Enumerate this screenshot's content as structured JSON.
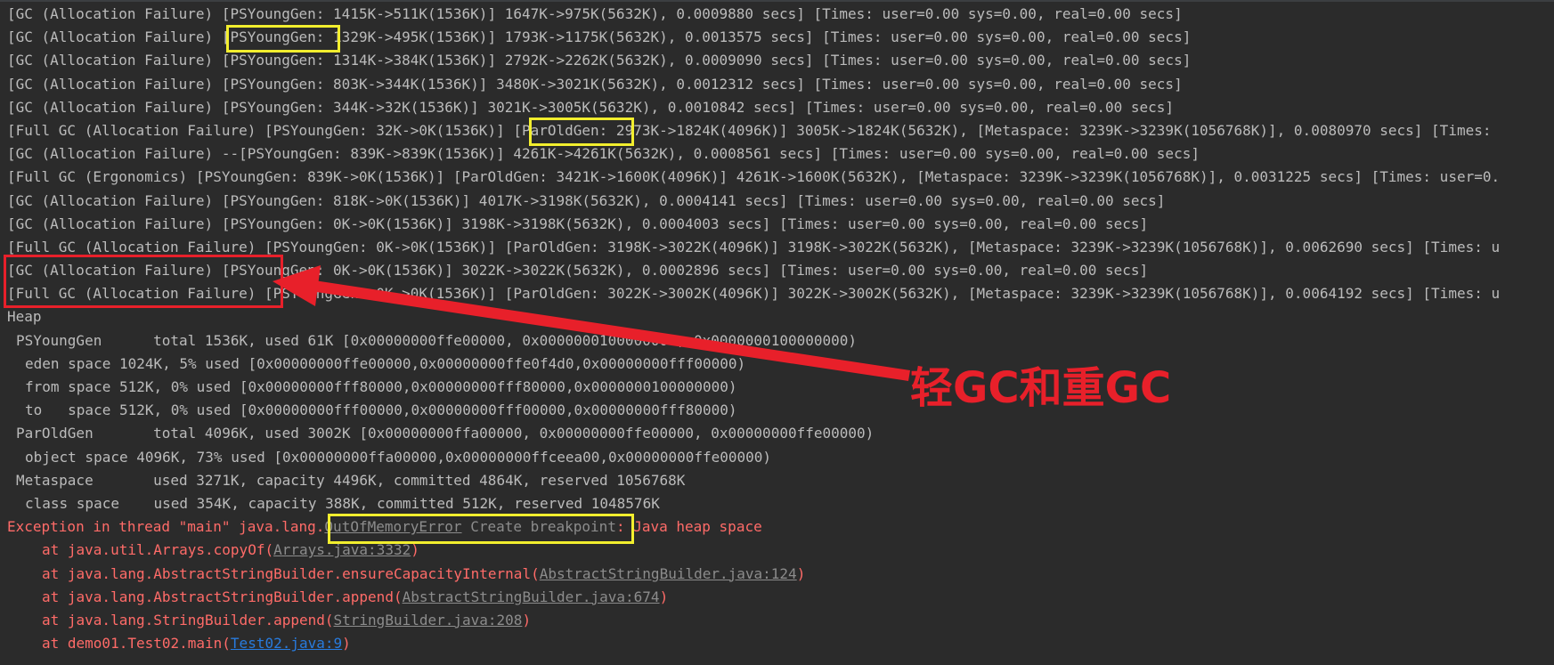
{
  "console": {
    "gc_lines": [
      "[GC (Allocation Failure) [PSYoungGen: 1415K->511K(1536K)] 1647K->975K(5632K), 0.0009880 secs] [Times: user=0.00 sys=0.00, real=0.00 secs]",
      "[GC (Allocation Failure) [PSYoungGen: 1329K->495K(1536K)] 1793K->1175K(5632K), 0.0013575 secs] [Times: user=0.00 sys=0.00, real=0.00 secs]",
      "[GC (Allocation Failure) [PSYoungGen: 1314K->384K(1536K)] 2792K->2262K(5632K), 0.0009090 secs] [Times: user=0.00 sys=0.00, real=0.00 secs]",
      "[GC (Allocation Failure) [PSYoungGen: 803K->344K(1536K)] 3480K->3021K(5632K), 0.0012312 secs] [Times: user=0.00 sys=0.00, real=0.00 secs]",
      "[GC (Allocation Failure) [PSYoungGen: 344K->32K(1536K)] 3021K->3005K(5632K), 0.0010842 secs] [Times: user=0.00 sys=0.00, real=0.00 secs]",
      "[Full GC (Allocation Failure) [PSYoungGen: 32K->0K(1536K)] [ParOldGen: 2973K->1824K(4096K)] 3005K->1824K(5632K), [Metaspace: 3239K->3239K(1056768K)], 0.0080970 secs] [Times:",
      "[GC (Allocation Failure) --[PSYoungGen: 839K->839K(1536K)] 4261K->4261K(5632K), 0.0008561 secs] [Times: user=0.00 sys=0.00, real=0.00 secs]",
      "[Full GC (Ergonomics) [PSYoungGen: 839K->0K(1536K)] [ParOldGen: 3421K->1600K(4096K)] 4261K->1600K(5632K), [Metaspace: 3239K->3239K(1056768K)], 0.0031225 secs] [Times: user=0.",
      "[GC (Allocation Failure) [PSYoungGen: 818K->0K(1536K)] 4017K->3198K(5632K), 0.0004141 secs] [Times: user=0.00 sys=0.00, real=0.00 secs]",
      "[GC (Allocation Failure) [PSYoungGen: 0K->0K(1536K)] 3198K->3198K(5632K), 0.0004003 secs] [Times: user=0.00 sys=0.00, real=0.00 secs]",
      "[Full GC (Allocation Failure) [PSYoungGen: 0K->0K(1536K)] [ParOldGen: 3198K->3022K(4096K)] 3198K->3022K(5632K), [Metaspace: 3239K->3239K(1056768K)], 0.0062690 secs] [Times: u",
      "[GC (Allocation Failure) [PSYoungGen: 0K->0K(1536K)] 3022K->3022K(5632K), 0.0002896 secs] [Times: user=0.00 sys=0.00, real=0.00 secs]",
      "[Full GC (Allocation Failure) [PSYoungGen: 0K->0K(1536K)] [ParOldGen: 3022K->3002K(4096K)] 3022K->3002K(5632K), [Metaspace: 3239K->3239K(1056768K)], 0.0064192 secs] [Times: u"
    ],
    "heap_title": "Heap",
    "heap_lines": [
      {
        "text": "PSYoungGen      total 1536K, used 61K [0x00000000ffe00000, 0x0000000100000000, 0x0000000100000000)",
        "level": 1
      },
      {
        "text": "eden space 1024K, 5% used [0x00000000ffe00000,0x00000000ffe0f4d0,0x00000000fff00000)",
        "level": 2
      },
      {
        "text": "from space 512K, 0% used [0x00000000fff80000,0x00000000fff80000,0x0000000100000000)",
        "level": 2
      },
      {
        "text": "to   space 512K, 0% used [0x00000000fff00000,0x00000000fff00000,0x00000000fff80000)",
        "level": 2
      },
      {
        "text": "ParOldGen       total 4096K, used 3002K [0x00000000ffa00000, 0x00000000ffe00000, 0x00000000ffe00000)",
        "level": 1
      },
      {
        "text": "object space 4096K, 73% used [0x00000000ffa00000,0x00000000ffceea00,0x00000000ffe00000)",
        "level": 2
      },
      {
        "text": "Metaspace       used 3271K, capacity 4496K, committed 4864K, reserved 1056768K",
        "level": 1
      },
      {
        "text": "class space    used 354K, capacity 388K, committed 512K, reserved 1048576K",
        "level": 2
      }
    ],
    "exception": {
      "prefix": "Exception in thread \"main\" java.lang.",
      "class_link": "OutOfMemoryError",
      "breakpoint_label": "Create breakpoint",
      "message": ": Java heap space"
    },
    "stack_trace": [
      {
        "prefix": "at java.util.Arrays.copyOf(",
        "link": "Arrays.java:3332",
        "suffix": ")",
        "user_code": false
      },
      {
        "prefix": "at java.lang.AbstractStringBuilder.ensureCapacityInternal(",
        "link": "AbstractStringBuilder.java:124",
        "suffix": ")",
        "user_code": false
      },
      {
        "prefix": "at java.lang.AbstractStringBuilder.append(",
        "link": "AbstractStringBuilder.java:674",
        "suffix": ")",
        "user_code": false
      },
      {
        "prefix": "at java.lang.StringBuilder.append(",
        "link": "StringBuilder.java:208",
        "suffix": ")",
        "user_code": false
      },
      {
        "prefix": "at demo01.Test02.main(",
        "link": "Test02.java:9",
        "suffix": ")",
        "user_code": true
      }
    ]
  },
  "annotation": {
    "text": "轻GC和重GC"
  },
  "colors": {
    "background": "#2b2b2b",
    "log_text": "#bbbbbb",
    "error_text": "#ff6b68",
    "lib_link": "#8c8c8c",
    "user_link": "#287bde",
    "highlight_yellow": "#f2ee2e",
    "highlight_red": "#e8202a"
  }
}
